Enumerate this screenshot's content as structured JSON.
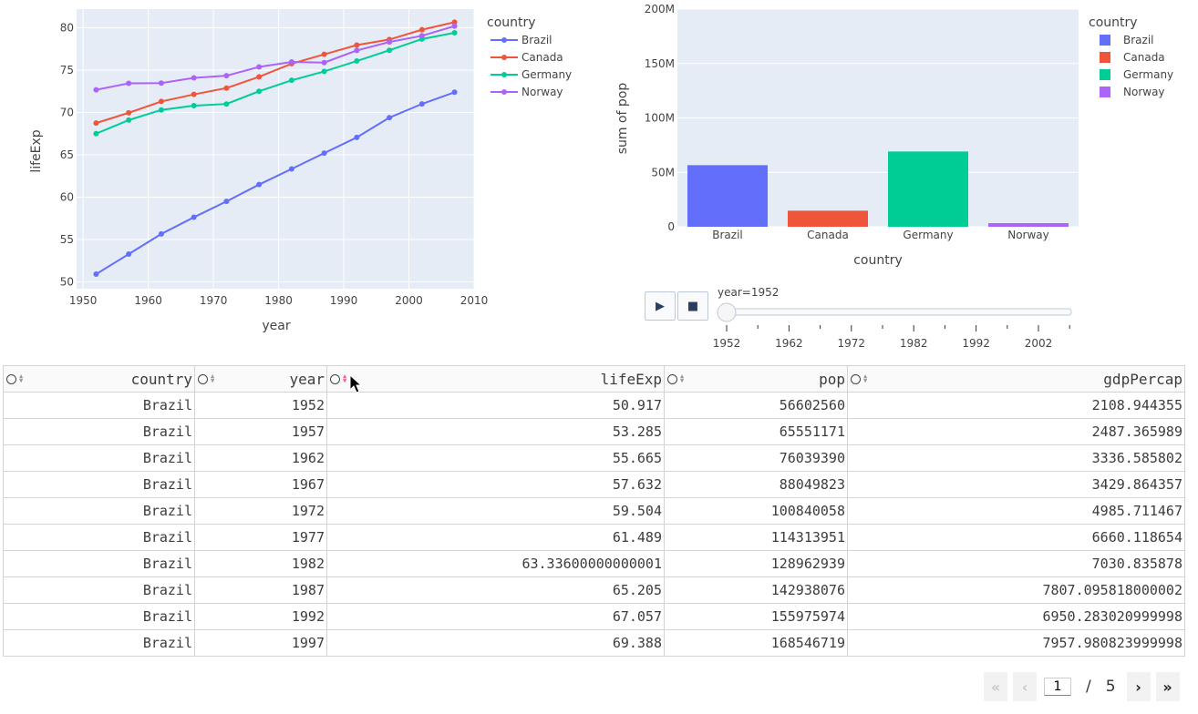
{
  "line_chart": {
    "xlabel": "year",
    "ylabel": "lifeExp",
    "legend_title": "country",
    "x_ticks": [
      1950,
      1960,
      1970,
      1980,
      1990,
      2000,
      2010
    ],
    "y_ticks": [
      50,
      55,
      60,
      65,
      70,
      75,
      80
    ]
  },
  "bar_chart": {
    "xlabel": "country",
    "ylabel": "sum of pop",
    "legend_title": "country",
    "y_tick_labels": [
      "0",
      "50M",
      "100M",
      "150M",
      "200M"
    ]
  },
  "chart_data": [
    {
      "type": "line",
      "xlabel": "year",
      "ylabel": "lifeExp",
      "xlim": [
        1949,
        2010
      ],
      "ylim": [
        49.2,
        82.2
      ],
      "x": [
        1952,
        1957,
        1962,
        1967,
        1972,
        1977,
        1982,
        1987,
        1992,
        1997,
        2002,
        2007
      ],
      "legend_title": "country",
      "legend_position": "top-right",
      "grid": true,
      "series": [
        {
          "name": "Brazil",
          "color": "#636efa",
          "values": [
            50.917,
            53.285,
            55.665,
            57.632,
            59.504,
            61.489,
            63.336,
            65.205,
            67.057,
            69.388,
            71.006,
            72.39
          ]
        },
        {
          "name": "Canada",
          "color": "#ef553b",
          "values": [
            68.75,
            69.96,
            71.3,
            72.13,
            72.88,
            74.21,
            75.76,
            76.86,
            77.95,
            78.61,
            79.77,
            80.653
          ]
        },
        {
          "name": "Germany",
          "color": "#00cc96",
          "values": [
            67.5,
            69.1,
            70.3,
            70.8,
            71.0,
            72.5,
            73.8,
            74.847,
            76.07,
            77.34,
            78.67,
            79.406
          ]
        },
        {
          "name": "Norway",
          "color": "#ab63fa",
          "values": [
            72.67,
            73.44,
            73.47,
            74.08,
            74.34,
            75.37,
            75.97,
            75.89,
            77.32,
            78.32,
            79.05,
            80.196
          ]
        }
      ]
    },
    {
      "type": "bar",
      "xlabel": "country",
      "ylabel": "sum of pop",
      "ylim": [
        0,
        200000000
      ],
      "categories": [
        "Brazil",
        "Canada",
        "Germany",
        "Norway"
      ],
      "values": [
        56602560,
        14785584,
        69145952,
        3327728
      ],
      "colors": [
        "#636efa",
        "#ef553b",
        "#00cc96",
        "#ab63fa"
      ],
      "legend_title": "country",
      "legend_position": "top-right",
      "grid": true
    }
  ],
  "slider": {
    "current_label": "year=1952",
    "tick_labels": [
      "1952",
      "1962",
      "1972",
      "1982",
      "1992",
      "2002"
    ],
    "play_label": "▶",
    "stop_label": "■",
    "value": 1952
  },
  "table": {
    "columns": [
      "country",
      "year",
      "lifeExp",
      "pop",
      "gdpPercap"
    ],
    "rows": [
      [
        "Brazil",
        "1952",
        "50.917",
        "56602560",
        "2108.944355"
      ],
      [
        "Brazil",
        "1957",
        "53.285",
        "65551171",
        "2487.365989"
      ],
      [
        "Brazil",
        "1962",
        "55.665",
        "76039390",
        "3336.585802"
      ],
      [
        "Brazil",
        "1967",
        "57.632",
        "88049823",
        "3429.864357"
      ],
      [
        "Brazil",
        "1972",
        "59.504",
        "100840058",
        "4985.711467"
      ],
      [
        "Brazil",
        "1977",
        "61.489",
        "114313951",
        "6660.118654"
      ],
      [
        "Brazil",
        "1982",
        "63.33600000000001",
        "128962939",
        "7030.835878"
      ],
      [
        "Brazil",
        "1987",
        "65.205",
        "142938076",
        "7807.095818000002"
      ],
      [
        "Brazil",
        "1992",
        "67.057",
        "155975974",
        "6950.283020999998"
      ],
      [
        "Brazil",
        "1997",
        "69.388",
        "168546719",
        "7957.980823999998"
      ]
    ]
  },
  "pagination": {
    "current_page": "1",
    "separator": "/",
    "total_pages": "5",
    "first_icon": "«",
    "prev_icon": "‹",
    "next_icon": "›",
    "last_icon": "»"
  }
}
